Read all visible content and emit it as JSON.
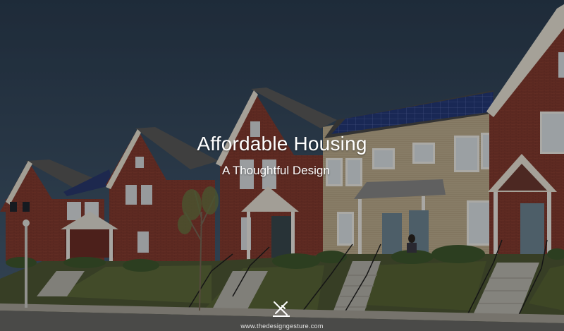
{
  "hero": {
    "title": "Affordable Housing",
    "subtitle": "A Thoughtful Design"
  },
  "footer": {
    "logo_icon": "pencil-ruler-cross-icon",
    "site_url": "www.thedesigngesture.com"
  },
  "colors": {
    "sky": "#35495e",
    "brick": "#8a3f33",
    "siding": "#b9a98a",
    "roof": "#4a4a4a",
    "solar_panel": "#243566",
    "grass": "#5d6b3a",
    "text": "#ffffff"
  }
}
